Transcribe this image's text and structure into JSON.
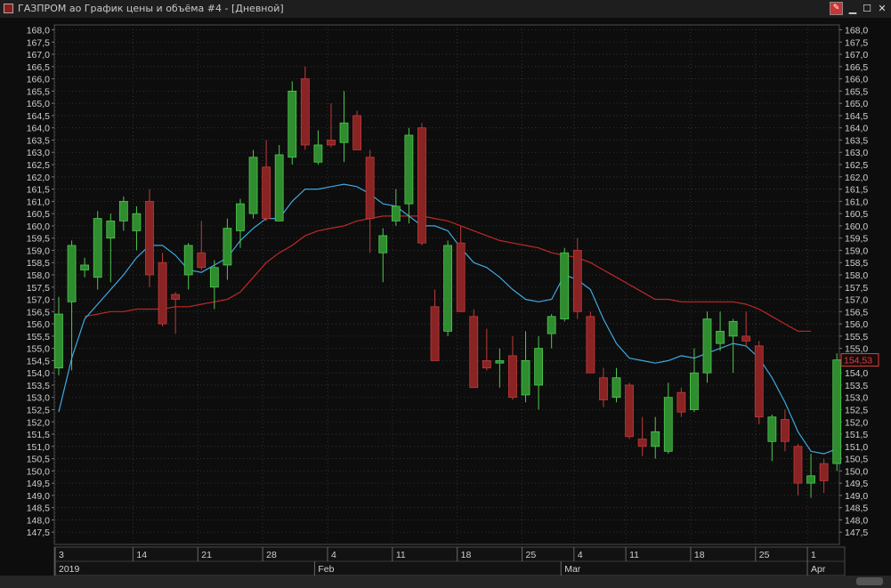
{
  "window": {
    "title": "ГАЗПРОМ ао График цены и объёма #4 - [Дневной]",
    "buttons": {
      "minimize": "▁",
      "maximize": "☐",
      "close": "✕"
    },
    "pin_icon": "pin-icon"
  },
  "colors": {
    "background": "#101010",
    "grid": "#3a3a3a",
    "axis_text": "#d0d0d0",
    "bull_fill": "#2f8c2f",
    "bull_edge": "#4ec94e",
    "bear_fill": "#8a2323",
    "bear_edge": "#c23b3b",
    "ma_fast": "#3fa8e0",
    "ma_slow": "#c02828",
    "last_price_label": "#e04040"
  },
  "chart_data": {
    "type": "candlestick",
    "title": "ГАЗПРОМ ао График цены и объёма #4",
    "ylim": [
      147.0,
      168.2
    ],
    "y_ticks": [
      "168,0",
      "167,5",
      "167,0",
      "166,5",
      "166,0",
      "165,5",
      "165,0",
      "164,5",
      "164,0",
      "163,5",
      "163,0",
      "162,5",
      "162,0",
      "161,5",
      "161,0",
      "160,5",
      "160,0",
      "159,5",
      "159,0",
      "158,5",
      "158,0",
      "157,5",
      "157,0",
      "156,5",
      "156,0",
      "155,5",
      "155,0",
      "154,5",
      "154,0",
      "153,5",
      "153,0",
      "152,5",
      "152,0",
      "151,5",
      "151,0",
      "150,5",
      "150,0",
      "149,5",
      "149,0",
      "148,5",
      "148,0",
      "147,5"
    ],
    "y_tick_values": [
      168.0,
      167.5,
      167.0,
      166.5,
      166.0,
      165.5,
      165.0,
      164.5,
      164.0,
      163.5,
      163.0,
      162.5,
      162.0,
      161.5,
      161.0,
      160.5,
      160.0,
      159.5,
      159.0,
      158.5,
      158.0,
      157.5,
      157.0,
      156.5,
      156.0,
      155.5,
      155.0,
      154.5,
      154.0,
      153.5,
      153.0,
      152.5,
      152.0,
      151.5,
      151.0,
      150.5,
      150.0,
      149.5,
      149.0,
      148.5,
      148.0,
      147.5
    ],
    "x_day_labels": [
      {
        "i": 0,
        "label": "3"
      },
      {
        "i": 6,
        "label": "14"
      },
      {
        "i": 11,
        "label": "21"
      },
      {
        "i": 16,
        "label": "28"
      },
      {
        "i": 21,
        "label": "4"
      },
      {
        "i": 26,
        "label": "11"
      },
      {
        "i": 31,
        "label": "18"
      },
      {
        "i": 36,
        "label": "25"
      },
      {
        "i": 40,
        "label": "4"
      },
      {
        "i": 44,
        "label": "11"
      },
      {
        "i": 49,
        "label": "18"
      },
      {
        "i": 54,
        "label": "25"
      },
      {
        "i": 58,
        "label": "1"
      }
    ],
    "x_month_labels": [
      {
        "i": 0,
        "label": "2019"
      },
      {
        "i": 20,
        "label": "Feb"
      },
      {
        "i": 39,
        "label": "Mar"
      },
      {
        "i": 58,
        "label": "Apr"
      }
    ],
    "last_price": "154,53",
    "last_price_value": 154.53,
    "candles": [
      {
        "o": 154.2,
        "h": 157.1,
        "l": 153.9,
        "c": 156.4
      },
      {
        "o": 156.9,
        "h": 159.4,
        "l": 154.1,
        "c": 159.2
      },
      {
        "o": 158.2,
        "h": 158.7,
        "l": 157.9,
        "c": 158.4
      },
      {
        "o": 157.9,
        "h": 160.6,
        "l": 157.4,
        "c": 160.3
      },
      {
        "o": 159.5,
        "h": 160.5,
        "l": 157.7,
        "c": 160.2
      },
      {
        "o": 160.2,
        "h": 161.2,
        "l": 159.8,
        "c": 161.0
      },
      {
        "o": 159.8,
        "h": 160.8,
        "l": 159.0,
        "c": 160.5
      },
      {
        "o": 161.0,
        "h": 161.5,
        "l": 157.5,
        "c": 158.0
      },
      {
        "o": 158.5,
        "h": 158.9,
        "l": 155.9,
        "c": 156.0
      },
      {
        "o": 157.2,
        "h": 157.3,
        "l": 155.6,
        "c": 157.0
      },
      {
        "o": 158.0,
        "h": 159.3,
        "l": 157.4,
        "c": 159.2
      },
      {
        "o": 158.9,
        "h": 160.2,
        "l": 158.2,
        "c": 158.3
      },
      {
        "o": 157.5,
        "h": 158.6,
        "l": 156.6,
        "c": 158.3
      },
      {
        "o": 158.4,
        "h": 160.3,
        "l": 157.8,
        "c": 159.9
      },
      {
        "o": 159.8,
        "h": 161.1,
        "l": 159.1,
        "c": 160.9
      },
      {
        "o": 160.5,
        "h": 163.1,
        "l": 160.3,
        "c": 162.8
      },
      {
        "o": 162.4,
        "h": 163.5,
        "l": 160.2,
        "c": 160.3
      },
      {
        "o": 160.2,
        "h": 163.3,
        "l": 160.2,
        "c": 162.9
      },
      {
        "o": 162.8,
        "h": 165.9,
        "l": 162.5,
        "c": 165.5
      },
      {
        "o": 166.0,
        "h": 166.5,
        "l": 163.1,
        "c": 163.3
      },
      {
        "o": 162.6,
        "h": 163.9,
        "l": 162.5,
        "c": 163.3
      },
      {
        "o": 163.5,
        "h": 165.0,
        "l": 163.2,
        "c": 163.3
      },
      {
        "o": 163.4,
        "h": 165.5,
        "l": 162.6,
        "c": 164.2
      },
      {
        "o": 164.5,
        "h": 164.7,
        "l": 163.2,
        "c": 163.1
      },
      {
        "o": 162.8,
        "h": 163.1,
        "l": 158.9,
        "c": 160.3
      },
      {
        "o": 158.9,
        "h": 159.9,
        "l": 157.7,
        "c": 159.6
      },
      {
        "o": 160.2,
        "h": 161.5,
        "l": 160.0,
        "c": 160.8
      },
      {
        "o": 160.9,
        "h": 164.0,
        "l": 160.1,
        "c": 163.7
      },
      {
        "o": 164.0,
        "h": 164.2,
        "l": 159.2,
        "c": 159.3
      },
      {
        "o": 156.7,
        "h": 157.4,
        "l": 154.5,
        "c": 154.5
      },
      {
        "o": 155.7,
        "h": 159.4,
        "l": 155.5,
        "c": 159.2
      },
      {
        "o": 159.3,
        "h": 160.0,
        "l": 156.5,
        "c": 156.5
      },
      {
        "o": 156.3,
        "h": 156.6,
        "l": 153.6,
        "c": 153.4
      },
      {
        "o": 154.5,
        "h": 155.8,
        "l": 154.1,
        "c": 154.2
      },
      {
        "o": 154.4,
        "h": 155.0,
        "l": 153.4,
        "c": 154.5
      },
      {
        "o": 154.7,
        "h": 155.5,
        "l": 152.9,
        "c": 153.0
      },
      {
        "o": 153.1,
        "h": 155.7,
        "l": 152.8,
        "c": 154.5
      },
      {
        "o": 153.5,
        "h": 155.5,
        "l": 152.5,
        "c": 155.0
      },
      {
        "o": 155.6,
        "h": 156.4,
        "l": 155.0,
        "c": 156.3
      },
      {
        "o": 156.2,
        "h": 159.1,
        "l": 156.1,
        "c": 158.9
      },
      {
        "o": 159.0,
        "h": 159.5,
        "l": 156.2,
        "c": 156.5
      },
      {
        "o": 156.3,
        "h": 156.5,
        "l": 154.3,
        "c": 154.0
      },
      {
        "o": 153.8,
        "h": 154.2,
        "l": 152.6,
        "c": 152.9
      },
      {
        "o": 153.0,
        "h": 154.2,
        "l": 152.8,
        "c": 153.8
      },
      {
        "o": 153.5,
        "h": 153.6,
        "l": 151.3,
        "c": 151.4
      },
      {
        "o": 151.3,
        "h": 152.2,
        "l": 150.6,
        "c": 151.0
      },
      {
        "o": 151.0,
        "h": 152.2,
        "l": 150.5,
        "c": 151.6
      },
      {
        "o": 150.8,
        "h": 153.6,
        "l": 150.7,
        "c": 153.0
      },
      {
        "o": 153.2,
        "h": 153.4,
        "l": 152.2,
        "c": 152.4
      },
      {
        "o": 152.5,
        "h": 155.0,
        "l": 152.4,
        "c": 154.0
      },
      {
        "o": 154.0,
        "h": 156.5,
        "l": 153.6,
        "c": 156.2
      },
      {
        "o": 155.2,
        "h": 156.5,
        "l": 154.9,
        "c": 155.7
      },
      {
        "o": 155.5,
        "h": 156.2,
        "l": 154.0,
        "c": 156.1
      },
      {
        "o": 155.5,
        "h": 156.5,
        "l": 155.1,
        "c": 155.3
      },
      {
        "o": 155.1,
        "h": 155.3,
        "l": 151.9,
        "c": 152.2
      },
      {
        "o": 151.2,
        "h": 152.3,
        "l": 150.4,
        "c": 152.2
      },
      {
        "o": 152.1,
        "h": 152.5,
        "l": 150.8,
        "c": 151.2
      },
      {
        "o": 151.0,
        "h": 151.1,
        "l": 149.0,
        "c": 149.5
      },
      {
        "o": 149.5,
        "h": 150.7,
        "l": 148.9,
        "c": 149.8
      },
      {
        "o": 150.3,
        "h": 150.5,
        "l": 149.1,
        "c": 149.6
      },
      {
        "o": 150.3,
        "h": 154.8,
        "l": 150.0,
        "c": 154.53
      }
    ],
    "ma_fast": [
      152.4,
      154.6,
      156.2,
      156.8,
      157.4,
      158.0,
      158.7,
      159.2,
      159.2,
      158.8,
      158.2,
      158.1,
      158.4,
      158.7,
      159.4,
      159.9,
      160.3,
      160.3,
      161.0,
      161.5,
      161.5,
      161.6,
      161.7,
      161.6,
      161.3,
      160.9,
      160.8,
      160.4,
      160.0,
      160.0,
      159.8,
      159.1,
      158.5,
      158.3,
      157.9,
      157.4,
      157.0,
      156.9,
      157.0,
      158.0,
      157.8,
      157.4,
      156.2,
      155.2,
      154.6,
      154.5,
      154.4,
      154.5,
      154.7,
      154.6,
      154.8,
      155.0,
      155.2,
      155.1,
      154.6,
      153.8,
      152.8,
      151.6,
      150.8,
      150.7,
      150.9
    ],
    "ma_slow": [
      null,
      null,
      156.3,
      156.4,
      156.5,
      156.5,
      156.6,
      156.6,
      156.6,
      156.7,
      156.7,
      156.8,
      156.9,
      157.0,
      157.3,
      157.9,
      158.5,
      158.9,
      159.2,
      159.6,
      159.8,
      159.9,
      160.0,
      160.2,
      160.3,
      160.4,
      160.4,
      160.4,
      160.4,
      160.3,
      160.2,
      160.0,
      159.8,
      159.6,
      159.4,
      159.3,
      159.2,
      159.1,
      158.9,
      158.8,
      158.7,
      158.5,
      158.2,
      157.9,
      157.6,
      157.3,
      157.0,
      157.0,
      156.9,
      156.9,
      156.9,
      156.9,
      156.9,
      156.8,
      156.6,
      156.3,
      156.0,
      155.7,
      155.7,
      null,
      null
    ]
  }
}
